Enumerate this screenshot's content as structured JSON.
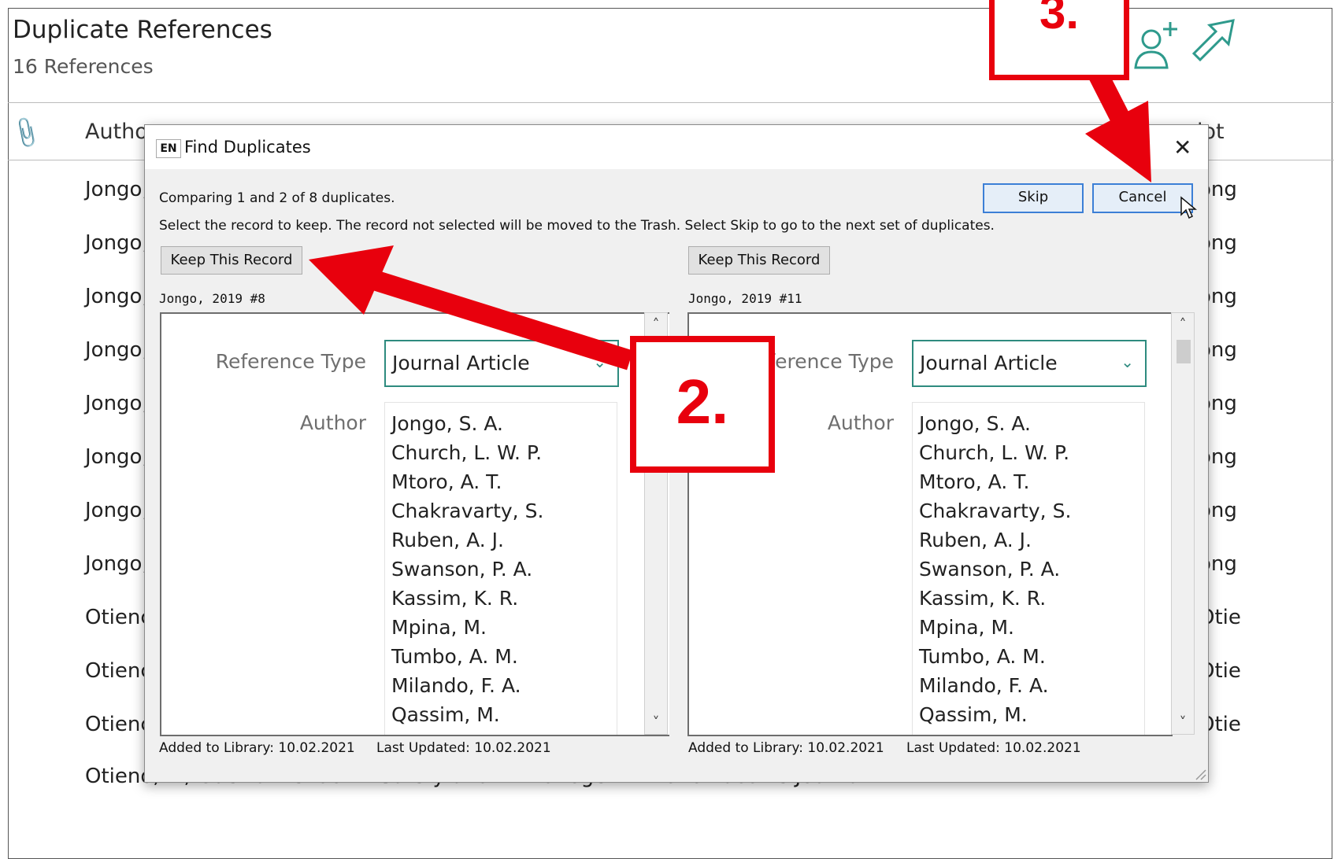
{
  "library": {
    "title": "Duplicate References",
    "subtitle": "16 References",
    "columns": {
      "author": "Autho",
      "notes": "lot"
    },
    "rows": [
      {
        "left": "Jongo,",
        "right": "ong"
      },
      {
        "left": "Jongo,",
        "right": "ong"
      },
      {
        "left": "Jongo,",
        "right": "ong"
      },
      {
        "left": "Jongo,",
        "right": "ong"
      },
      {
        "left": "Jongo,",
        "right": "ong"
      },
      {
        "left": "Jongo,",
        "right": "ong"
      },
      {
        "left": "Jongo,",
        "right": "ong"
      },
      {
        "left": "Jongo,",
        "right": "ong"
      },
      {
        "left": "Otienc",
        "right": "Otie"
      },
      {
        "left": "Otienc",
        "right": "Otie"
      },
      {
        "left": "Otienc",
        "right": "Otie"
      }
    ],
    "last_row": "Otieno, L., Guerra Mendoz...    Safety and Immunogeni...    2020    Vaccine    Journal...    1..."
  },
  "dialog": {
    "app_badge": "EN",
    "title": "Find Duplicates",
    "message": "Comparing 1 and 2 of 8 duplicates.",
    "instruction": "Select the record to keep. The record not selected will be moved to the Trash. Select Skip to go to the next set of duplicates.",
    "skip_label": "Skip",
    "cancel_label": "Cancel",
    "left": {
      "keep_label": "Keep This Record",
      "record_label": "Jongo, 2019 #8",
      "ref_type_label": "Reference Type",
      "ref_type_value": "Journal Article",
      "author_label": "Author",
      "authors": [
        "Jongo, S. A.",
        "Church, L. W. P.",
        "Mtoro, A. T.",
        "Chakravarty, S.",
        "Ruben, A. J.",
        "Swanson, P. A.",
        "Kassim, K. R.",
        "Mpina, M.",
        "Tumbo, A. M.",
        "Milando, F. A.",
        "Qassim, M."
      ],
      "added": "Added to Library: 10.02.2021",
      "updated": "Last Updated: 10.02.2021"
    },
    "right": {
      "keep_label": "Keep This Record",
      "record_label": "Jongo, 2019 #11",
      "ref_type_label": "Reference Type",
      "ref_type_value": "Journal Article",
      "author_label": "Author",
      "authors": [
        "Jongo, S. A.",
        "Church, L. W. P.",
        "Mtoro, A. T.",
        "Chakravarty, S.",
        "Ruben, A. J.",
        "Swanson, P. A.",
        "Kassim, K. R.",
        "Mpina, M.",
        "Tumbo, A. M.",
        "Milando, F. A.",
        "Qassim, M."
      ],
      "added": "Added to Library: 10.02.2021",
      "updated": "Last Updated: 10.02.2021"
    }
  },
  "annotations": {
    "step2": "2.",
    "step3": "3.",
    "color": "#e8000d"
  },
  "icons": [
    "paperclip-icon",
    "add-user-icon",
    "share-icon",
    "close-icon",
    "chevron-down-icon",
    "scroll-up-icon",
    "scroll-down-icon",
    "mouse-cursor-icon",
    "resize-grip-icon"
  ]
}
